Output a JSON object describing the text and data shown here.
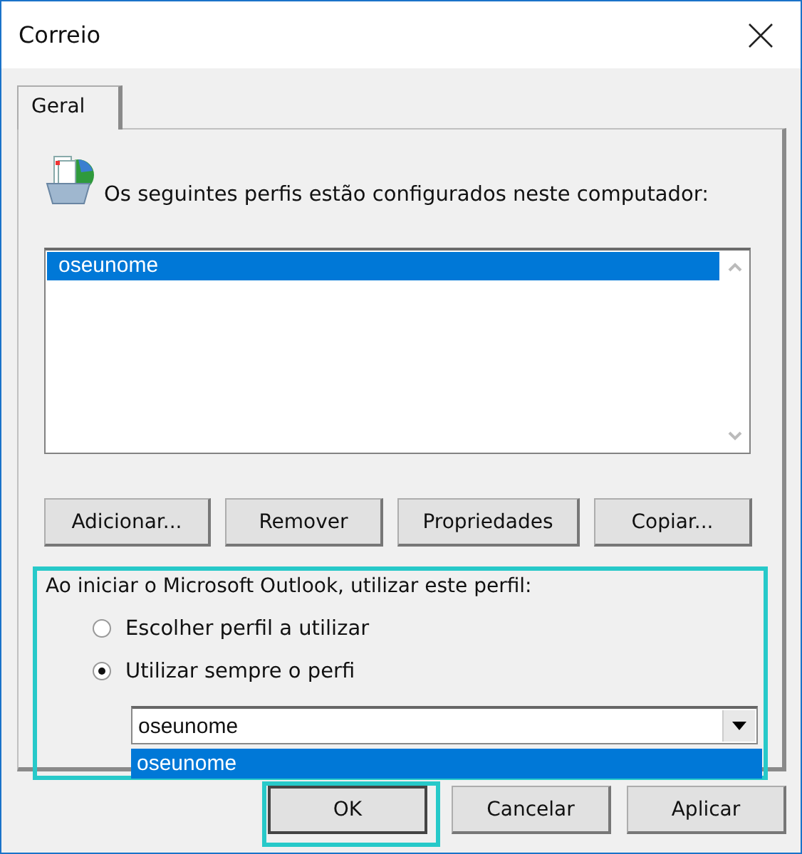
{
  "window": {
    "title": "Correio"
  },
  "tabs": [
    {
      "label": "Geral",
      "selected": true
    }
  ],
  "profiles_label": "Os seguintes perfis estão configurados neste computador:",
  "profiles": [
    {
      "name": "oseunome",
      "selected": true
    }
  ],
  "profile_buttons": [
    "Adicionar...",
    "Remover",
    "Propriedades",
    "Copiar..."
  ],
  "startup": {
    "label": "Ao iniciar o Microsoft Outlook, utilizar este perfil:",
    "highlighted": true,
    "options": [
      {
        "label": "Escolher perfil a utilizar",
        "selected": false
      },
      {
        "label": "Utilizar sempre o perfi",
        "selected": true
      }
    ],
    "combo": {
      "value": "oseunome",
      "expanded": true,
      "options": [
        {
          "label": "oseunome",
          "selected": true
        }
      ]
    }
  },
  "dialog_buttons": [
    {
      "label": "OK",
      "highlighted": true
    },
    {
      "label": "Cancelar",
      "highlighted": false
    },
    {
      "label": "Aplicar",
      "highlighted": false
    }
  ]
}
